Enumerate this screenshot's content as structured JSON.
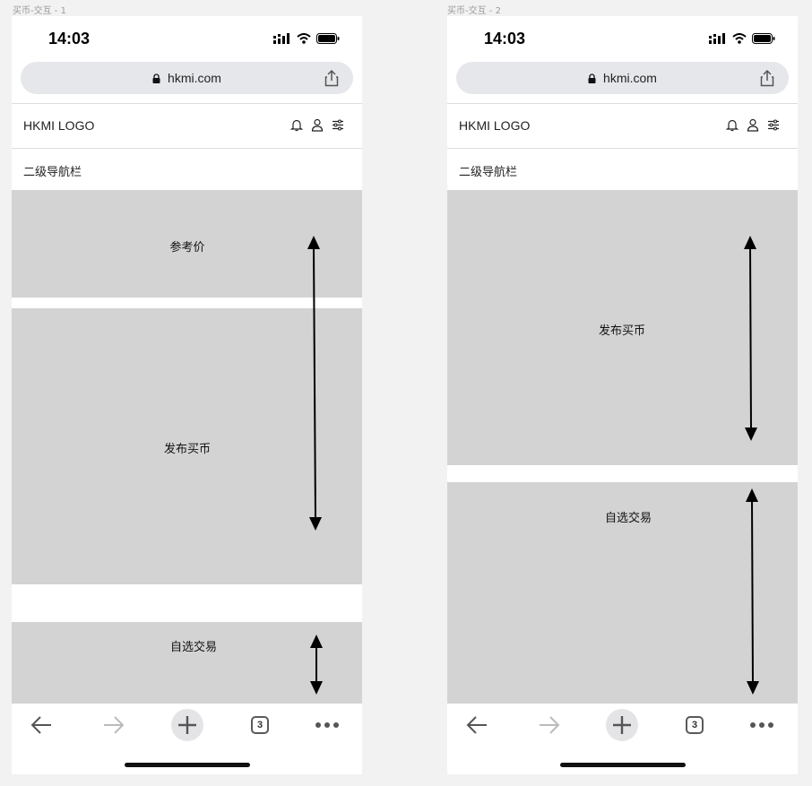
{
  "frames": [
    {
      "label": "买币-交互 - 1",
      "status_time": "14:03",
      "url": "hkmi.com",
      "logo": "HKMI LOGO",
      "subnav": "二级导航栏",
      "sections": [
        "参考价",
        "发布买币",
        "自选交易"
      ],
      "tabs_count": "3"
    },
    {
      "label": "买币-交互 - 2",
      "status_time": "14:03",
      "url": "hkmi.com",
      "logo": "HKMI LOGO",
      "subnav": "二级导航栏",
      "sections": [
        "发布买币",
        "自选交易"
      ],
      "tabs_count": "3"
    }
  ],
  "colors": {
    "block_gray": "#d3d3d3",
    "background": "#f2f2f2",
    "arrow": "#000000"
  },
  "icons": [
    "lock-icon",
    "share-icon",
    "bell-icon",
    "user-icon",
    "filter-icon",
    "back-arrow-icon",
    "forward-arrow-icon",
    "plus-icon",
    "tabs-icon",
    "more-icon",
    "signal-icon",
    "wifi-icon",
    "battery-icon"
  ]
}
